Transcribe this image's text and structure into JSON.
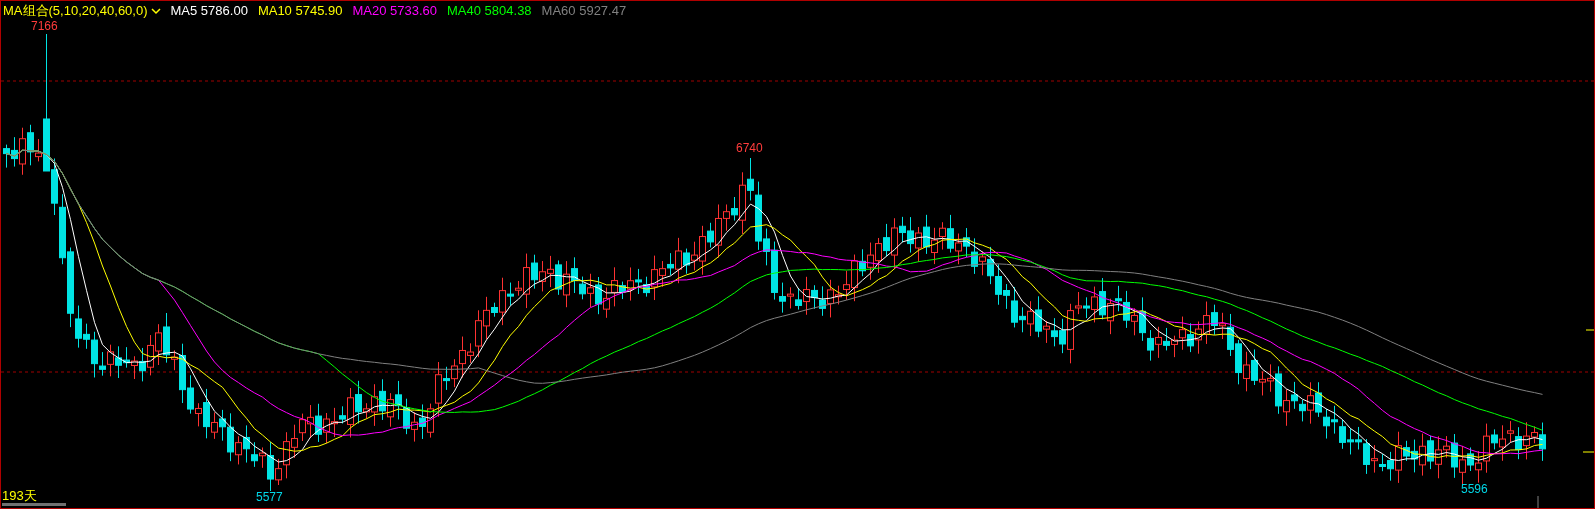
{
  "legend": {
    "indicator": "MA组合(5,10,20,40,60,0)",
    "averages": [
      {
        "label": "MA5",
        "value": "5786.00",
        "color": "#ffffff"
      },
      {
        "label": "MA10",
        "value": "5745.90",
        "color": "#ffff00"
      },
      {
        "label": "MA20",
        "value": "5733.60",
        "color": "#ff00ff"
      },
      {
        "label": "MA40",
        "value": "5804.38",
        "color": "#00ff00"
      },
      {
        "label": "MA60",
        "value": "5927.47",
        "color": "#808080"
      }
    ]
  },
  "price_marks": [
    {
      "kind": "high",
      "text": "7166"
    },
    {
      "kind": "high",
      "text": "6740"
    },
    {
      "kind": "low",
      "text": "5577"
    },
    {
      "kind": "low",
      "text": "5596"
    }
  ],
  "period": "193天"
}
